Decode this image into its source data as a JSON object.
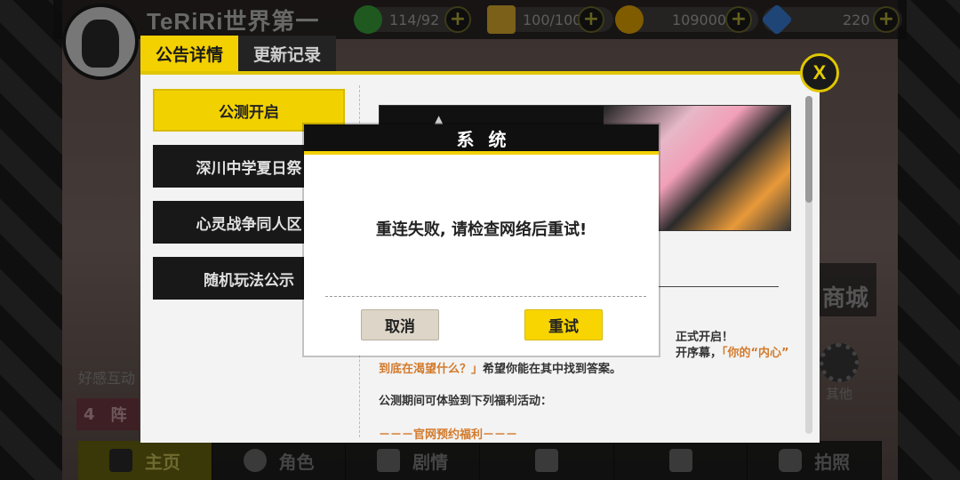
{
  "player": {
    "name": "TeRiRi世界第一"
  },
  "resources": [
    {
      "icon": "stamina-icon",
      "value": "114/92",
      "color": "#3aa33a"
    },
    {
      "icon": "ticket-icon",
      "value": "100/100",
      "color": "#e0b030"
    },
    {
      "icon": "coin-icon",
      "value": "109000",
      "color": "#e8a800"
    },
    {
      "icon": "diamond-icon",
      "value": "220",
      "color": "#3a7fd8"
    }
  ],
  "tabs": [
    {
      "label": "公告详情",
      "active": true
    },
    {
      "label": "更新记录",
      "active": false
    }
  ],
  "announcements": [
    {
      "label": "公测开启",
      "active": true
    },
    {
      "label": "深川中学夏日祭",
      "active": false
    },
    {
      "label": "心灵战争同人区",
      "active": false
    },
    {
      "label": "随机玩法公示",
      "active": false
    }
  ],
  "content": {
    "right_line1": "正式开启！",
    "right_line2_a": "开序幕，",
    "right_line2_b": "「你的“内心”",
    "line_orange": "到底在渴望什么？」",
    "line_rest": "希望你能在其中找到答案。",
    "line3": "公测期间可体验到下列福利活动：",
    "line4": "－－－官网预约福利－－－"
  },
  "side": {
    "left_label": "好感互动",
    "badge_num": "4",
    "badge_text": "阵",
    "store_label": "商城",
    "other_label": "其他"
  },
  "bottom_nav": [
    {
      "label": "主页",
      "icon": "home-icon",
      "active": true
    },
    {
      "label": "角色",
      "icon": "character-icon",
      "active": false
    },
    {
      "label": "剧情",
      "icon": "story-icon",
      "active": false
    },
    {
      "label": "",
      "icon": "lock-icon",
      "active": false
    },
    {
      "label": "",
      "icon": "lock-icon",
      "active": false
    },
    {
      "label": "拍照",
      "icon": "camera-icon",
      "active": false
    }
  ],
  "dialog": {
    "title": "系统",
    "message": "重连失败, 请检查网络后重试!",
    "cancel_label": "取消",
    "retry_label": "重试"
  },
  "close_label": "X",
  "colors": {
    "accent": "#f2d100",
    "dark": "#101010",
    "orange_text": "#d27a2b"
  }
}
